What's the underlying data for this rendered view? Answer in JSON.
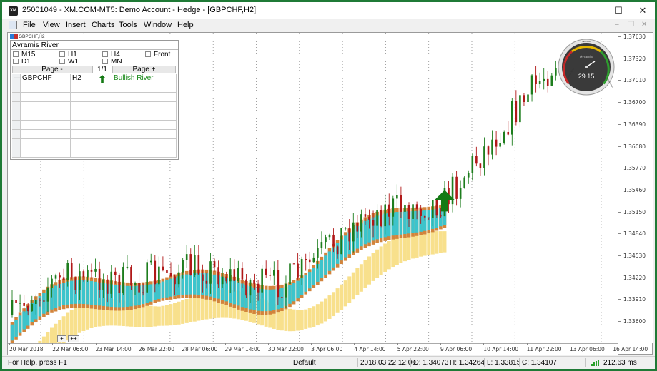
{
  "window": {
    "title": "25001049 - XM.COM-MT5: Demo Account - Hedge - [GBPCHF,H2]",
    "app_icon_label": "XM",
    "minimize_glyph": "—",
    "maximize_glyph": "☐",
    "close_glyph": "✕"
  },
  "menu": {
    "items": [
      "File",
      "View",
      "Insert",
      "Charts",
      "Tools",
      "Window",
      "Help"
    ],
    "mdi_minimize": "–",
    "mdi_restore": "❐",
    "mdi_close": "✕"
  },
  "chart": {
    "symbol_label": "GBPCHF,H2",
    "price_ticks": [
      "1.37630",
      "1.37320",
      "1.37010",
      "1.36700",
      "1.36390",
      "1.36080",
      "1.35770",
      "1.35460",
      "1.35150",
      "1.34840",
      "1.34530",
      "1.34220",
      "1.33910",
      "1.33600"
    ],
    "time_ticks": [
      "20 Mar 2018",
      "22 Mar 06:00",
      "23 Mar 14:00",
      "26 Mar 22:00",
      "28 Mar 06:00",
      "29 Mar 14:00",
      "30 Mar 22:00",
      "3 Apr 06:00",
      "4 Apr 14:00",
      "5 Apr 22:00",
      "9 Apr 06:00",
      "10 Apr 14:00",
      "11 Apr 22:00",
      "13 Apr 06:00",
      "16 Apr 14:00"
    ],
    "zoom_out_label": "+",
    "zoom_in_label": "++",
    "colors": {
      "bull_candle": "#1d7d1d",
      "bear_candle": "#b01818",
      "river_cyan": "#3cc4cc",
      "river_orange": "#d2843c",
      "river_yellow": "#f8e08c",
      "signal_arrow": "#157a15"
    }
  },
  "panel": {
    "title": "Avramis River",
    "timeframes": [
      {
        "label": "M15",
        "checked": false
      },
      {
        "label": "H1",
        "checked": false
      },
      {
        "label": "H4",
        "checked": false
      },
      {
        "label": "Front",
        "checked": false
      },
      {
        "label": "D1",
        "checked": false
      },
      {
        "label": "W1",
        "checked": false
      },
      {
        "label": "MN",
        "checked": false
      }
    ],
    "page_prev": "Page -",
    "page_indicator": "1/1",
    "page_next": "Page +",
    "rows": [
      {
        "marker": "—",
        "symbol": "GBPCHF",
        "timeframe": "H2",
        "signal_icon": "arrow-up-icon",
        "status": "Bullish River"
      }
    ],
    "status_color": "#1a8a1a"
  },
  "gauge": {
    "value": "29.15",
    "brand_label": "Avramis",
    "scale_labels": [
      "STRONG SELL",
      "SELL",
      "NEUTRAL",
      "BUY",
      "STRONG BUY"
    ]
  },
  "status_bar": {
    "help_text": "For Help, press F1",
    "profile": "Default",
    "datetime": "2018.03.22 12:00",
    "open": "O: 1.34073",
    "high": "H: 1.34264",
    "low": "L: 1.33815",
    "close": "C: 1.34107",
    "ping": "212.63 ms"
  }
}
